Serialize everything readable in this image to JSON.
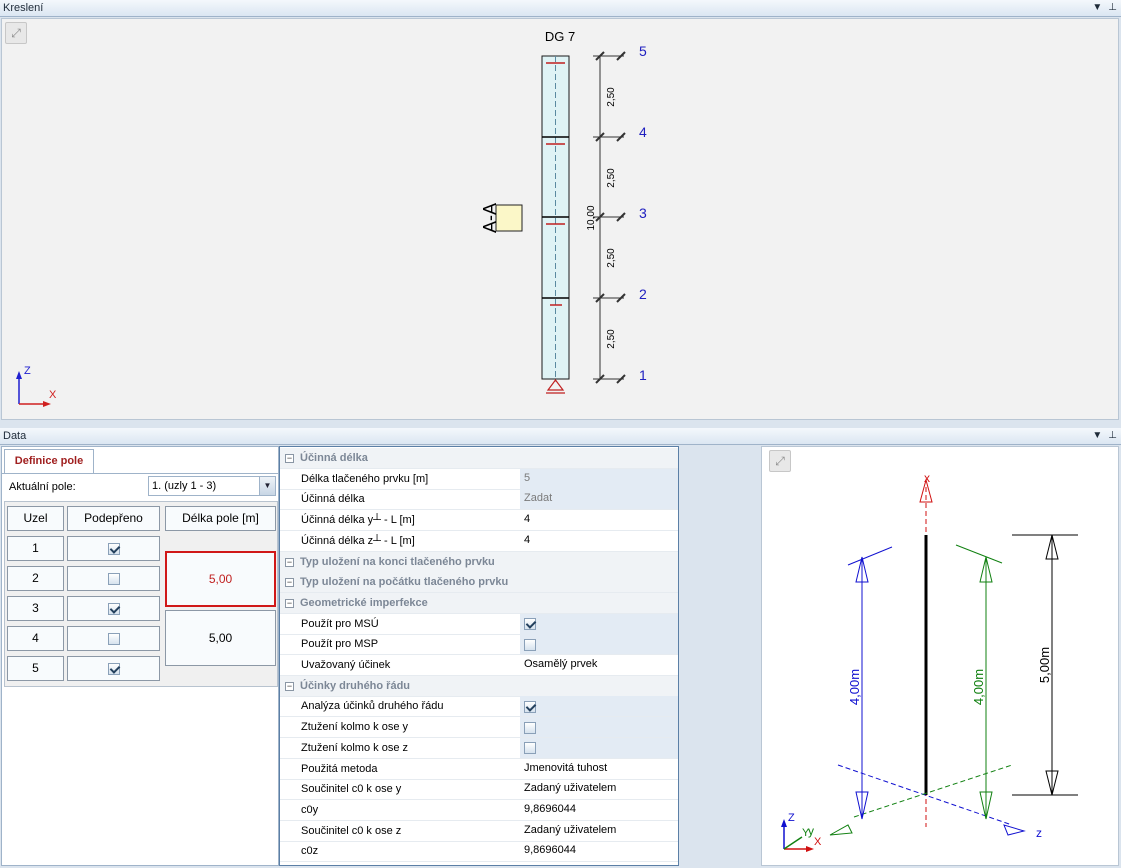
{
  "top_panel": {
    "title": "Kreslení",
    "pin_icon": "▾ ⊥"
  },
  "drawing": {
    "member_name": "DG 7",
    "section_label": "A-A",
    "total_dim": "10,00",
    "segment_dims": [
      "2,50",
      "2,50",
      "2,50",
      "2,50"
    ],
    "node_labels": [
      "5",
      "4",
      "3",
      "2",
      "1"
    ],
    "axis_z": "Z",
    "axis_x": "X"
  },
  "bottom_panel": {
    "title": "Data"
  },
  "definition": {
    "tab_label": "Definice pole",
    "current_label": "Aktuální pole:",
    "current_value": "1. (uzly 1 - 3)",
    "columns": [
      "Uzel",
      "Podepřeno",
      "Délka pole [m]"
    ],
    "rows": [
      {
        "node": "1",
        "supported": true
      },
      {
        "node": "2",
        "supported": false
      },
      {
        "node": "3",
        "supported": true
      },
      {
        "node": "4",
        "supported": false
      },
      {
        "node": "5",
        "supported": true
      }
    ],
    "spans": [
      "5,00",
      "5,00"
    ]
  },
  "properties": [
    {
      "type": "group",
      "label": "Účinná délka"
    },
    {
      "type": "row",
      "label": "Délka tlačeného prvku [m]",
      "value": "5",
      "grey": true
    },
    {
      "type": "row",
      "label": "Účinná délka",
      "value": "Zadat",
      "grey": true
    },
    {
      "type": "row",
      "label": "Účinná délka y┴ - L [m]",
      "value": "4"
    },
    {
      "type": "row",
      "label": "Účinná délka z┴ - L [m]",
      "value": "4"
    },
    {
      "type": "group",
      "label": "Typ uložení na konci tlačeného prvku",
      "collapsed": true
    },
    {
      "type": "group",
      "label": "Typ uložení na počátku tlačeného prvku",
      "collapsed": true
    },
    {
      "type": "group",
      "label": "Geometrické imperfekce"
    },
    {
      "type": "check",
      "label": "Použít pro MSÚ",
      "checked": true
    },
    {
      "type": "check",
      "label": "Použít pro MSP",
      "checked": false
    },
    {
      "type": "row",
      "label": "Uvažovaný účinek",
      "value": "Osamělý prvek"
    },
    {
      "type": "group",
      "label": "Účinky druhého řádu"
    },
    {
      "type": "check",
      "label": "Analýza účinků druhého řádu",
      "checked": true
    },
    {
      "type": "check",
      "label": "Ztužení kolmo k ose y",
      "checked": false
    },
    {
      "type": "check",
      "label": "Ztužení kolmo k ose z",
      "checked": false
    },
    {
      "type": "row",
      "label": "Použitá metoda",
      "value": "Jmenovitá tuhost"
    },
    {
      "type": "row",
      "label": "Součinitel c0 k ose y",
      "value": "Zadaný uživatelem"
    },
    {
      "type": "row",
      "label": "c0y",
      "value": "9,8696044"
    },
    {
      "type": "row",
      "label": "Součinitel c0 k ose z",
      "value": "Zadaný uživatelem"
    },
    {
      "type": "row",
      "label": "c0z",
      "value": "9,8696044"
    }
  ],
  "view3d": {
    "dim_y": "4,00m",
    "dim_z": "4,00m",
    "dim_total": "5,00m",
    "axis_x": "x",
    "axis_y": "y",
    "axis_z": "z",
    "triad_z": "Z",
    "triad_y": "Y",
    "triad_x": "X"
  },
  "colors": {
    "blue": "#1010d0",
    "green": "#108010",
    "red": "#d01010"
  }
}
